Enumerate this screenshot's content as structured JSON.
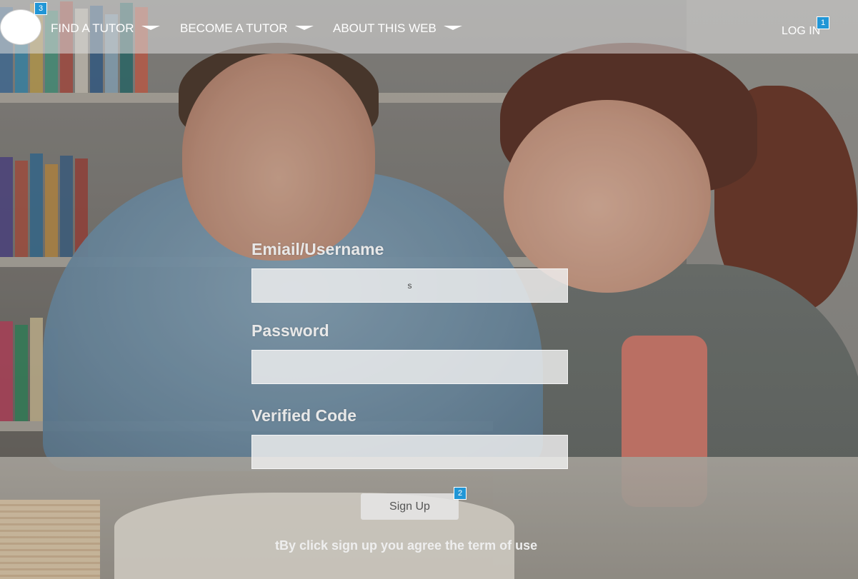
{
  "header": {
    "logo_badge": "3",
    "nav": [
      {
        "label": "FIND A TUTOR"
      },
      {
        "label": "BECOME A TUTOR"
      },
      {
        "label": "ABOUT THIS WEB"
      }
    ],
    "login_label": "LOG IN",
    "login_badge": "1"
  },
  "form": {
    "email_label": "Emiail/Username",
    "email_value": "s",
    "password_label": "Password",
    "password_value": "",
    "code_label": "Verified Code",
    "code_value": "",
    "signup_label": "Sign Up",
    "signup_badge": "2",
    "terms_text": "tBy click sign up you agree the term of use"
  },
  "colors": {
    "badge": "#2196d6",
    "header_overlay": "rgba(220,220,220,0.55)"
  },
  "icons": [
    "chevron-down-icon"
  ]
}
